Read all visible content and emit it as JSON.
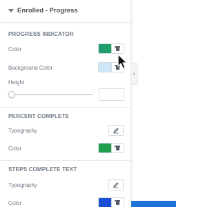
{
  "panel": {
    "title": "Enrolled - Progress"
  },
  "progress_indicator": {
    "section_title": "PROGRESS INDICATOR",
    "color_label": "Color",
    "color_value": "#1e9e6a",
    "bg_color_label": "Background Color",
    "bg_color_value": "#cfe6f7",
    "height_label": "Height",
    "height_value": ""
  },
  "percent_complete": {
    "section_title": "PERCENT COMPLETE",
    "typography_label": "Typography",
    "color_label": "Color",
    "color_value": "#1e9e4e"
  },
  "steps_complete_text": {
    "section_title": "STEPS COMPLETE TEXT",
    "typography_label": "Typography",
    "color_label": "Color",
    "color_value": "#1c4fd8"
  },
  "icons": {
    "collapse": "caret-down-icon",
    "delete": "trash-icon",
    "edit": "pencil-icon",
    "toggle": "chevron-left-icon",
    "cursor": "mouse-pointer-icon"
  },
  "colors": {
    "accent_bar": "#1e73d6"
  }
}
